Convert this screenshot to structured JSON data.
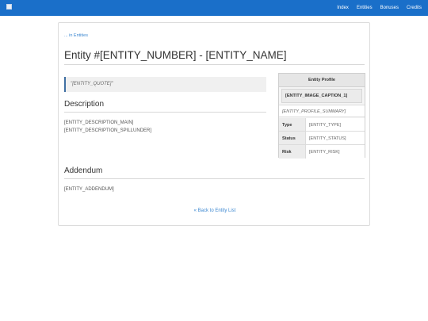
{
  "nav": {
    "links": [
      "Index",
      "Entities",
      "Bonuses",
      "Credits"
    ]
  },
  "breadcrumb": "... in Entities",
  "page": {
    "title": "Entity #[ENTITY_NUMBER] - [ENTITY_NAME]",
    "quote": "\"[ENTITY_QUOTE]\""
  },
  "description": {
    "heading": "Description",
    "main": "[ENTITY_DESCRIPTION_MAIN]",
    "spillunder": "[ENTITY_DESCRIPTION_SPILLUNDER]"
  },
  "profile": {
    "header": "Entity Profile",
    "image_caption": "[ENTITY_IMAGE_CAPTION_1]",
    "summary": "[ENTITY_PROFILE_SUMMARY]",
    "rows": [
      {
        "label": "Type",
        "value": "[ENTITY_TYPE]"
      },
      {
        "label": "Status",
        "value": "[ENTITY_STATUS]"
      },
      {
        "label": "Risk",
        "value": "[ENTITY_RISK]"
      }
    ]
  },
  "addendum": {
    "heading": "Addendum",
    "text": "[ENTITY_ADDENDUM]"
  },
  "back_link": "« Back to Entity List",
  "colors": {
    "navbar": "#1a6fc9",
    "link": "#3a86d0",
    "quote_border": "#3f6fa3"
  }
}
